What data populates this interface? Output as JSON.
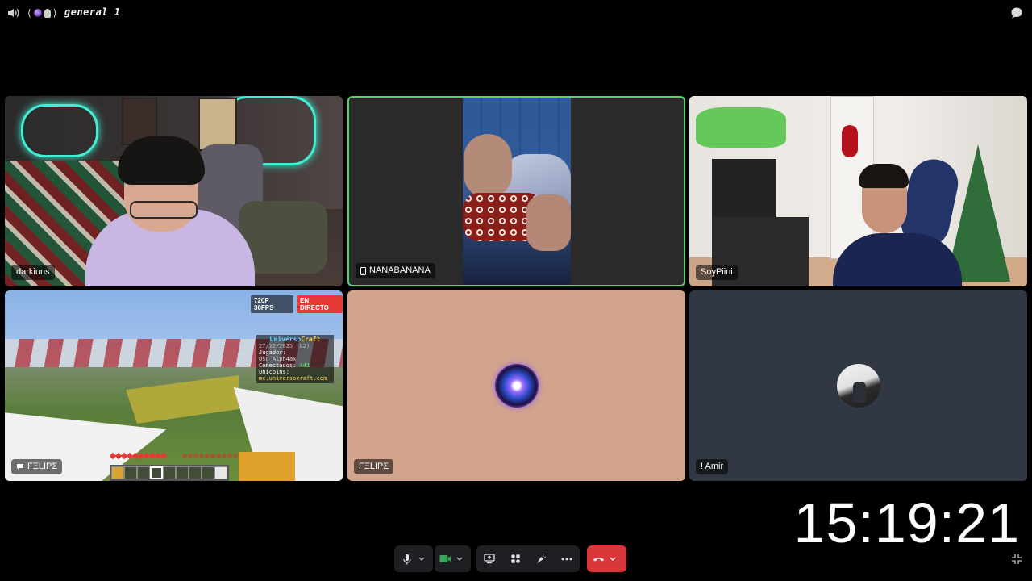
{
  "topbar": {
    "channel_name": "general 1",
    "deco_brackets_left": "⟨",
    "deco_brackets_right": "⟩"
  },
  "tiles": [
    {
      "name": "darkiuns",
      "icon": "none",
      "speaking": false
    },
    {
      "name": "NANABANANA",
      "icon": "mobile-phone-icon",
      "speaking": true
    },
    {
      "name": "SoyPiini",
      "icon": "none",
      "speaking": false
    },
    {
      "name": "FΞLIPΣ",
      "icon": "stream-chat-icon",
      "speaking": false
    },
    {
      "name": "FΞLIPΣ",
      "icon": "none",
      "speaking": false
    },
    {
      "name": "! Amir",
      "icon": "none",
      "speaking": false
    }
  ],
  "stream": {
    "resolution_badge": "720P 30FPS",
    "live_badge": "EN DIRECTO",
    "scoreboard": {
      "title_a": "Universo",
      "title_b": "Craft",
      "date": "27/12/2025 (L2)",
      "player_label": "Jugador:",
      "player_value": " Usu  Alph4ax",
      "connected_label": "Conectados:",
      "connected_value": "441",
      "coins_label": "Unicoins:",
      "url": "mc.universocraft.com"
    }
  },
  "clock": "15:19:21",
  "controls": {
    "mic": "microphone-icon",
    "camera": "camera-icon",
    "share": "screen-share-icon",
    "activities": "activities-icon",
    "soundboard": "soundboard-icon",
    "more": "more-icon",
    "hangup": "hang-up-icon"
  },
  "colors": {
    "background": "#000000",
    "speaking_border": "#4cd964",
    "hangup_red": "#da373c",
    "camera_green": "#3ba55d",
    "tile_felipe_bg": "#d3a48c",
    "tile_amir_bg": "#313843"
  }
}
